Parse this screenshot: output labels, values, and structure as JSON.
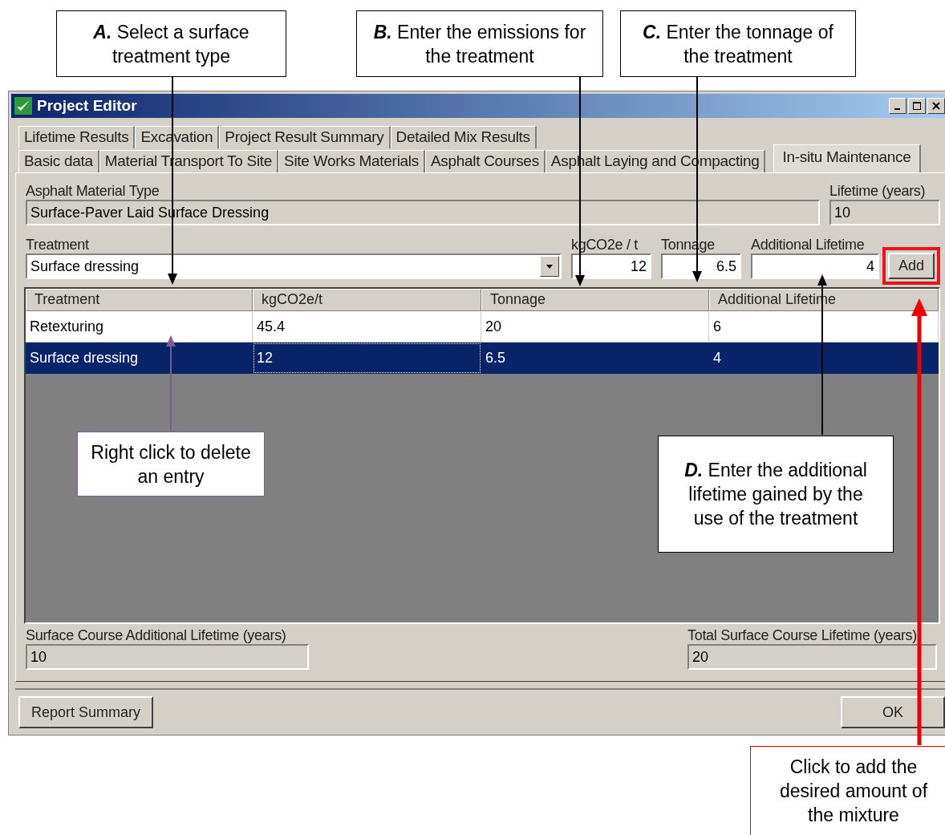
{
  "window": {
    "title": "Project Editor"
  },
  "tabs": [
    [
      {
        "label": "Lifetime Results",
        "selected": false
      },
      {
        "label": "Excavation",
        "selected": false
      },
      {
        "label": "Project Result Summary",
        "selected": false
      },
      {
        "label": "Detailed Mix Results",
        "selected": false
      }
    ],
    [
      {
        "label": "Basic data",
        "selected": false
      },
      {
        "label": "Material Transport To Site",
        "selected": false
      },
      {
        "label": "Site Works Materials",
        "selected": false
      },
      {
        "label": "Asphalt Courses",
        "selected": false
      },
      {
        "label": "Asphalt Laying and Compacting",
        "selected": false
      },
      {
        "label": "In-situ Maintenance",
        "selected": true
      }
    ]
  ],
  "material_type": {
    "label": "Asphalt Material Type",
    "value": "Surface-Paver Laid Surface Dressing"
  },
  "lifetime": {
    "label": "Lifetime (years)",
    "value": "10"
  },
  "treatment": {
    "label": "Treatment",
    "value": "Surface dressing"
  },
  "kgco2e": {
    "label": "kgCO2e / t",
    "value": "12"
  },
  "tonnage": {
    "label": "Tonnage",
    "value": "6.5"
  },
  "additional_lifetime": {
    "label": "Additional Lifetime",
    "value": "4"
  },
  "add_button": {
    "label": "Add",
    "highlighted": true
  },
  "table": {
    "columns": [
      "Treatment",
      "kgCO2e/t",
      "Tonnage",
      "Additional Lifetime"
    ],
    "rows": [
      {
        "cells": [
          "Retexturing",
          "45.4",
          "20",
          "6"
        ],
        "selected": false
      },
      {
        "cells": [
          "Surface dressing",
          "12",
          "6.5",
          "4"
        ],
        "selected": true
      }
    ]
  },
  "surface_additional": {
    "label": "Surface Course Additional Lifetime (years)",
    "value": "10"
  },
  "total_lifetime": {
    "label": "Total Surface Course Lifetime (years)",
    "value": "20"
  },
  "buttons": [
    "Report Summary",
    "OK"
  ],
  "callouts": [
    {
      "letter": "A.",
      "text": "Select a surface treatment type",
      "color": "#000000"
    },
    {
      "letter": "B.",
      "text": "Enter the emissions for the treatment",
      "color": "#000000"
    },
    {
      "letter": "C.",
      "text": "Enter the tonnage of the treatment",
      "color": "#000000"
    },
    {
      "text": "Right click to delete an entry",
      "color": "#7a5c9a"
    },
    {
      "letter": "D.",
      "text": "Enter the additional lifetime gained by the use of the treatment",
      "color": "#000000"
    },
    {
      "text": "Click to add the desired amount of the mixture",
      "color": "#ee0000"
    }
  ]
}
